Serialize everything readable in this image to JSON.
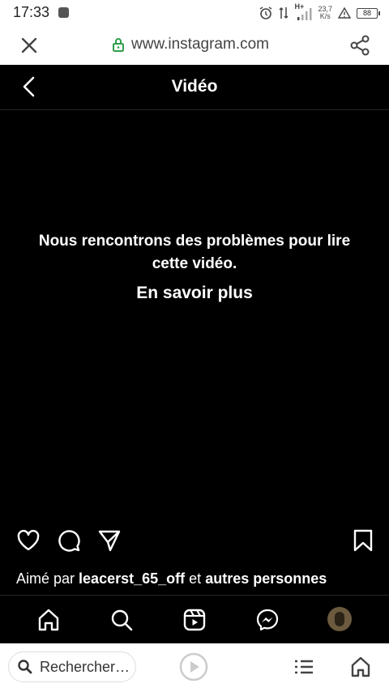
{
  "status_bar": {
    "time": "17:33",
    "network": "H+",
    "rate_value": "23,7",
    "rate_unit": "K/s",
    "battery": "88",
    "icons": [
      "alarm-icon",
      "data-arrows-icon",
      "signal-icon",
      "warning-icon",
      "battery-icon"
    ]
  },
  "browser": {
    "url": "www.instagram.com",
    "search_placeholder": "Rechercher…",
    "lock_color": "#2e9e4b"
  },
  "header": {
    "title": "Vidéo"
  },
  "video": {
    "error_message": "Nous rencontrons des problèmes pour lire cette vidéo.",
    "learn_more": "En savoir plus"
  },
  "post": {
    "liked_prefix": "Aimé par",
    "liked_user": "leacerst_65_off",
    "liked_connector": "et",
    "liked_others": "autres personnes"
  },
  "nav": [
    "home-icon",
    "search-icon",
    "reels-icon",
    "messenger-icon",
    "profile-avatar"
  ]
}
